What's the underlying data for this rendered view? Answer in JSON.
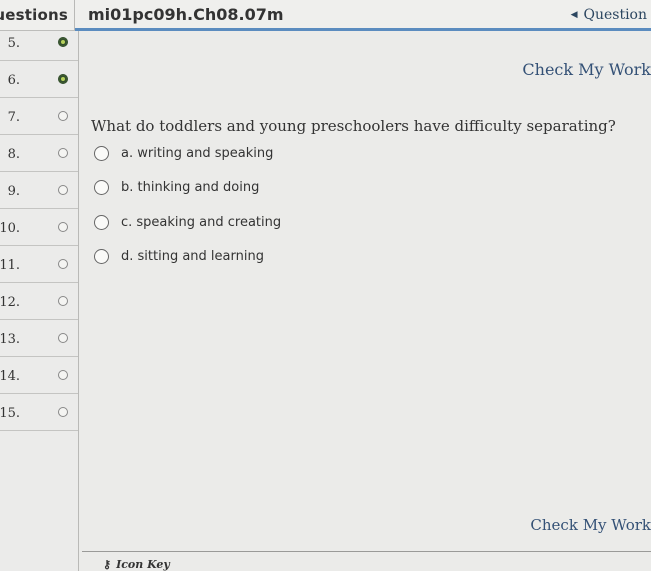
{
  "header": {
    "left_tab_label": "Questions",
    "assignment_title": "mi01pc09h.Ch08.07m",
    "nav_label": "Question",
    "nav_arrow_icon": "triangle-left-icon"
  },
  "sidebar": {
    "rows": [
      {
        "number": "5.",
        "status": "complete"
      },
      {
        "number": "6.",
        "status": "complete"
      },
      {
        "number": "7.",
        "status": "current"
      },
      {
        "number": "8.",
        "status": "unanswered"
      },
      {
        "number": "9.",
        "status": "unanswered"
      },
      {
        "number": "10.",
        "status": "unanswered"
      },
      {
        "number": "11.",
        "status": "unanswered"
      },
      {
        "number": "12.",
        "status": "unanswered"
      },
      {
        "number": "13.",
        "status": "unanswered"
      },
      {
        "number": "14.",
        "status": "unanswered"
      },
      {
        "number": "15.",
        "status": "unanswered"
      }
    ]
  },
  "main": {
    "check_top_label": "Check My Work",
    "question": "What do toddlers and young preschoolers have difficulty separating?",
    "choices": [
      {
        "label": "a. writing and speaking"
      },
      {
        "label": "b. thinking and doing"
      },
      {
        "label": "c. speaking and creating"
      },
      {
        "label": "d. sitting and learning"
      }
    ],
    "check_bottom_label": "Check My Work",
    "icon_key_label": "Icon Key"
  }
}
